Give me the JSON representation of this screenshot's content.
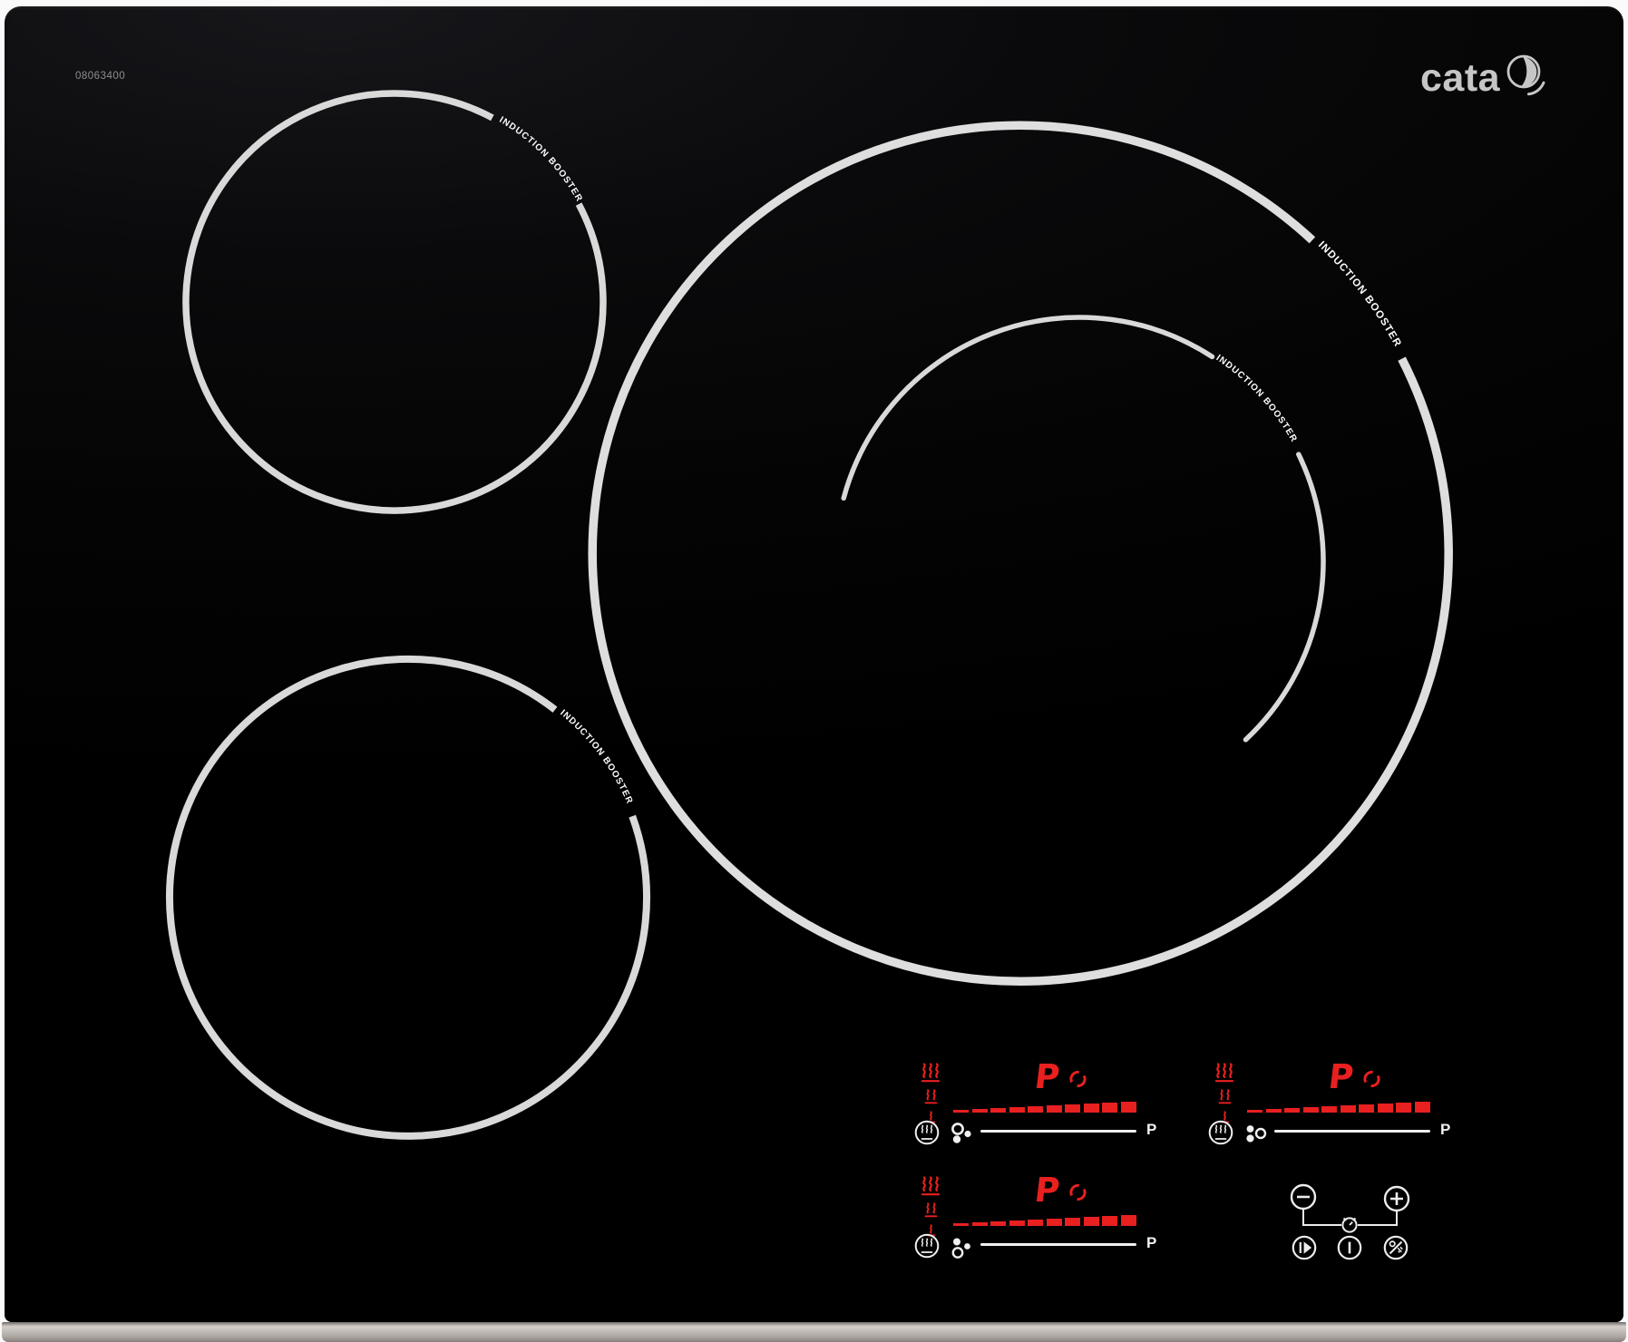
{
  "brand": {
    "name": "cata",
    "logo_icon": "cata-ring-swoosh-icon"
  },
  "model_number": "08063400",
  "hob": {
    "zones": [
      {
        "name": "rear-left-zone",
        "ring_label": "INDUCTION BOOSTER"
      },
      {
        "name": "front-left-zone",
        "ring_label": "INDUCTION BOOSTER"
      },
      {
        "name": "right-zone-outer",
        "ring_label": "INDUCTION BOOSTER"
      },
      {
        "name": "right-zone-inner",
        "ring_label": "INDUCTION BOOSTER"
      }
    ]
  },
  "panels": [
    {
      "name": "rear-right-zone-panel",
      "display_value": "P",
      "booster_label": "P",
      "power_segments": 10
    },
    {
      "name": "far-right-zone-panel",
      "display_value": "P",
      "booster_label": "P",
      "power_segments": 10
    },
    {
      "name": "front-zone-panel",
      "display_value": "P",
      "booster_label": "P",
      "power_segments": 10
    }
  ],
  "controls": {
    "minus_icon": "minus-icon",
    "plus_icon": "plus-icon",
    "timer_icon": "timer-icon",
    "play_pause_icon": "play-pause-icon",
    "power_icon": "power-icon",
    "key_lock_icon": "key-lock-icon"
  },
  "colors": {
    "led_red": "#e8201f",
    "ring_gray": "#d9d9d9",
    "panel_white": "#f0f0f0",
    "metal_trim": "#b7b1ad",
    "glass_black": "#050505"
  }
}
